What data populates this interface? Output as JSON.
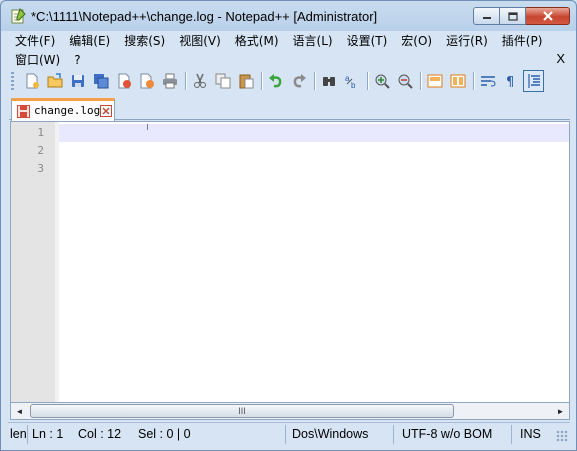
{
  "window": {
    "title": "*C:\\1111\\Notepad++\\change.log - Notepad++ [Administrator]",
    "close_glyph": "✕",
    "min_glyph": "—",
    "max_glyph": "□"
  },
  "menu": {
    "row1": [
      "文件(F)",
      "编辑(E)",
      "搜索(S)",
      "视图(V)",
      "格式(M)",
      "语言(L)",
      "设置(T)",
      "宏(O)",
      "运行(R)",
      "插件(P)"
    ],
    "row2": [
      "窗口(W)",
      "?"
    ],
    "close_label": "X"
  },
  "toolbar": {
    "icons": [
      "new-file-icon",
      "open-file-icon",
      "save-icon",
      "save-all-icon",
      "close-icon",
      "close-all-icon",
      "print-icon",
      "cut-icon",
      "copy-icon",
      "paste-icon",
      "undo-icon",
      "redo-icon",
      "find-icon",
      "replace-icon",
      "zoom-in-icon",
      "zoom-out-icon",
      "sync-vertical-icon",
      "sync-horizontal-icon",
      "word-wrap-icon",
      "show-all-chars-icon",
      "indent-guide-icon"
    ]
  },
  "tabs": [
    {
      "label": "change.log",
      "modified": true
    }
  ],
  "editor": {
    "line_numbers": [
      "1",
      "2",
      "3"
    ]
  },
  "scrollbar": {
    "left_glyph": "◄",
    "right_glyph": "►",
    "thumb_grip": "III"
  },
  "status": {
    "length": "len",
    "ln": "Ln : 1",
    "col": "Col : 12",
    "sel": "Sel : 0 | 0",
    "eol": "Dos\\Windows",
    "encoding": "UTF-8 w/o BOM",
    "mode": "INS"
  },
  "colors": {
    "tab_accent": "#f5a04a",
    "current_line": "#e8e8ff",
    "gutter": "#e4e4e4",
    "close_button": "#c8442e"
  }
}
